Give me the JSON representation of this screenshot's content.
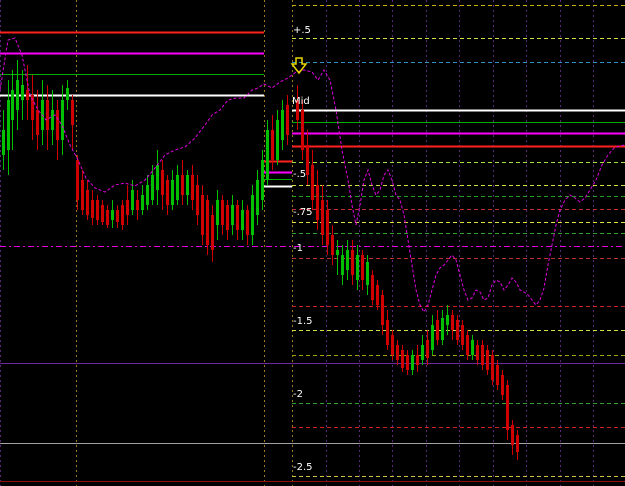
{
  "chart": {
    "background": "#000000",
    "colors": {
      "bull": "#00c000",
      "bear": "#d00000",
      "ma": "#e000e0",
      "red_level": "#ff2020",
      "magenta_level": "#ff00ff",
      "green_level": "#00b000",
      "white_level": "#ffffff",
      "grid_vertical": "#9a7a1a",
      "grid_violet": "#5a2a7a"
    },
    "level_labels": [
      "+.5",
      "Mid",
      "-.5",
      "-.75",
      "-1",
      "-1.5",
      "-2",
      "-2.5"
    ],
    "marker_icon": "down-arrow-icon",
    "marker_color": "#e8d800"
  }
}
